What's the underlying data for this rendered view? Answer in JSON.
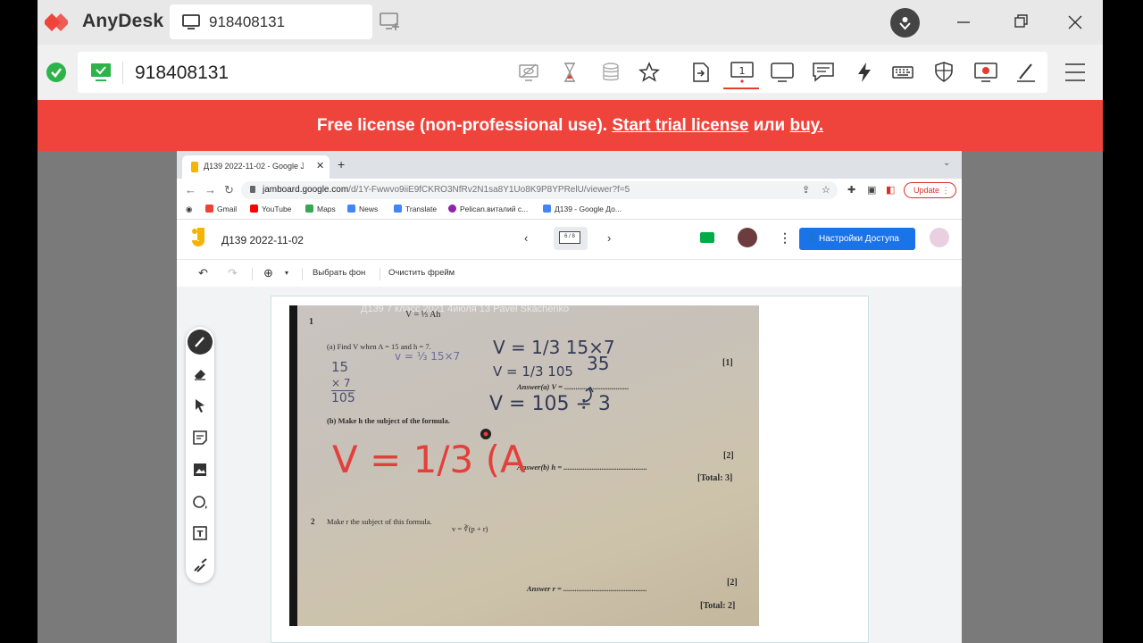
{
  "app": {
    "title": "AnyDesk",
    "tab_id": "918408131"
  },
  "toolbar": {
    "session_id": "918408131",
    "display_number": "1"
  },
  "banner": {
    "text": "Free license (non-professional use).",
    "trial_link": "Start trial license",
    "or_word": "или",
    "buy_link": "buy."
  },
  "browser": {
    "tab_title": "Д139 2022-11-02 - Google Jamboard",
    "url_host": "jamboard.google.com",
    "url_path": "/d/1Y-Fwwvo9iiE9fCKRO3NfRv2N1sa8Y1Uo8K9P8YPRelU/viewer?f=5",
    "update_label": "Update",
    "bookmarks": [
      {
        "label": "Gmail",
        "color": "#ea4335"
      },
      {
        "label": "YouTube",
        "color": "#ff0000"
      },
      {
        "label": "Maps",
        "color": "#34a853"
      },
      {
        "label": "News",
        "color": "#4285f4"
      },
      {
        "label": "Translate",
        "color": "#4285f4"
      },
      {
        "label": "Pelican.виталий с...",
        "color": "#8e24aa"
      },
      {
        "label": "Д139 - Google До...",
        "color": "#4285f4"
      }
    ]
  },
  "jamboard": {
    "title": "Д139 2022-11-02",
    "frame_indicator": "6 / 8",
    "share_label": "Настройки Доступа",
    "toolbar": {
      "set_background": "Выбрать фон",
      "clear_frame": "Очистить фрейм"
    }
  },
  "worksheet": {
    "overlay_caption": "Д139 7 класс 2021 4июля 13 Pavel Skachenko",
    "q1_number": "1",
    "q1_formula": "V = ⅓ Ah",
    "q1a": "(a)  Find V when A = 15 and h = 7.",
    "q1a_answer": "Answer(a) V = ..................................",
    "q1a_marks": "[1]",
    "q1b": "(b)  Make h the subject of the formula.",
    "q1b_answer": "Answer(b) h = ............................................",
    "q1b_marks": "[2]",
    "q1_total": "[Total: 3]",
    "q2_number": "2",
    "q2": "Make r the subject of this formula.",
    "q2_formula": "v = ∛(p + r)",
    "q2_answer": "Answer    r = ............................................",
    "q2_marks": "[2]",
    "q2_total": "[Total: 2]",
    "handwriting": {
      "left_15": "15",
      "left_x7": "× 7",
      "left_105": "105",
      "mid_formula": "v = ⅓ 15×7",
      "big_formula": "V = 1/3 15×7",
      "v_105": "V = 1/3 105",
      "answer_35": "35",
      "result": "V = 105 ÷ 3",
      "red": "V = 1/3 (A"
    }
  }
}
